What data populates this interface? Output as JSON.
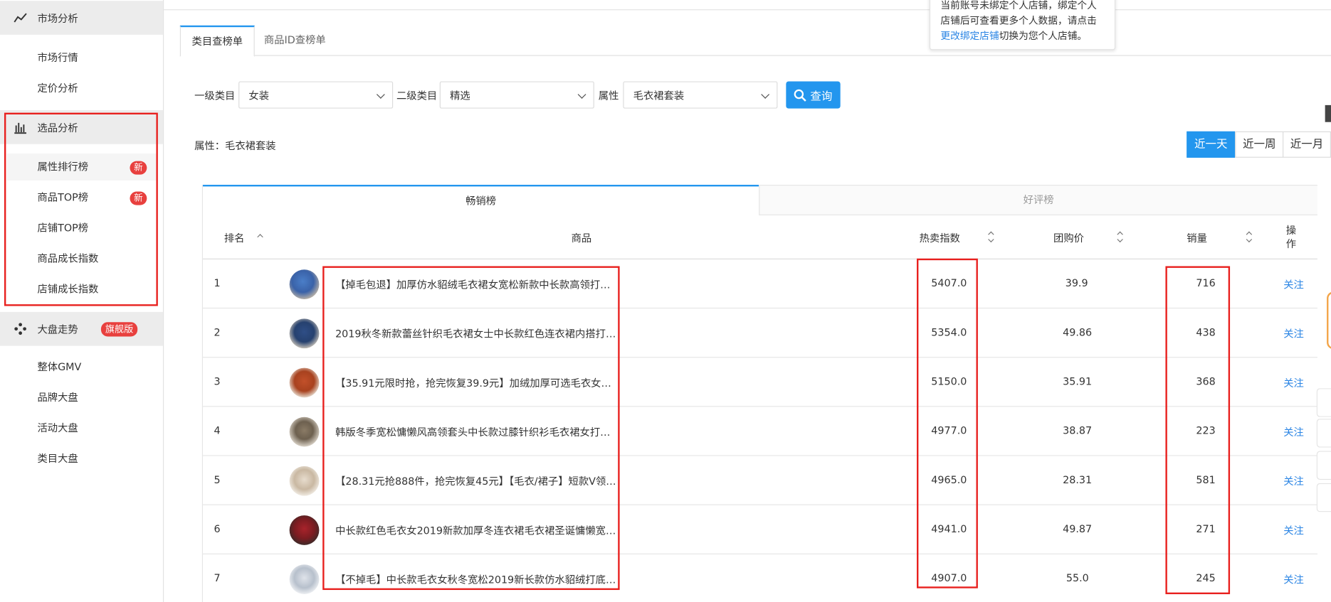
{
  "sidebar": {
    "market": {
      "title": "市场分析",
      "items": [
        "市场行情",
        "定价分析"
      ]
    },
    "selection": {
      "title": "选品分析",
      "items": [
        "属性排行榜",
        "商品TOP榜",
        "店铺TOP榜",
        "商品成长指数",
        "店铺成长指数"
      ],
      "new_badge": "新"
    },
    "overview": {
      "title": "大盘走势",
      "badge": "旗舰版",
      "items": [
        "整体GMV",
        "品牌大盘",
        "活动大盘",
        "类目大盘"
      ]
    }
  },
  "tabs": [
    "类目查榜单",
    "商品ID查榜单"
  ],
  "filters": {
    "cat1_label": "一级类目",
    "cat1_value": "女装",
    "cat2_label": "二级类目",
    "cat2_value": "精选",
    "attr_label": "属性",
    "attr_value": "毛衣裙套装",
    "query_label": "查询"
  },
  "attr_line": "属性：毛衣裙套装",
  "periods": [
    "近一天",
    "近一周",
    "近一月"
  ],
  "popover": {
    "line1": "当前账号未绑定个人店铺，绑定个人",
    "line2": "店铺后可查看更多个人数据，请点击",
    "link": "更改绑定店铺",
    "line3_rest": "切换为您个人店铺。"
  },
  "table": {
    "tabs": [
      "畅销榜",
      "好评榜"
    ],
    "headers": {
      "rank": "排名",
      "product": "商品",
      "hot": "热卖指数",
      "price": "团购价",
      "sales": "销量",
      "action": "操作"
    },
    "action_label": "关注",
    "rows": [
      {
        "rank": "1",
        "name": "【掉毛包退】加厚仿水貂绒毛衣裙女宽松新款中长款高领打底针织衫",
        "hot": "5407.0",
        "price": "39.9",
        "sales": "716"
      },
      {
        "rank": "2",
        "name": "2019秋冬新款蕾丝针织毛衣裙女士中长款红色连衣裙内搭打底衫加厚",
        "hot": "5354.0",
        "price": "49.86",
        "sales": "438"
      },
      {
        "rank": "3",
        "name": "【35.91元限时抢，抢完恢复39.9元】加绒加厚可选毛衣女宽松中长款…",
        "hot": "5150.0",
        "price": "35.91",
        "sales": "368"
      },
      {
        "rank": "4",
        "name": "韩版冬季宽松慵懒风高领套头中长款过膝针织衫毛衣裙女打底衫加厚",
        "hot": "4977.0",
        "price": "38.87",
        "sales": "223"
      },
      {
        "rank": "5",
        "name": "【28.31元抢888件，抢完恢复45元】【毛衣/裙子】短款V领针织衫女…",
        "hot": "4965.0",
        "price": "28.31",
        "sales": "581"
      },
      {
        "rank": "6",
        "name": "中长款红色毛衣女2019新款加厚冬连衣裙毛衣裙圣诞慵懒宽松外穿潮",
        "hot": "4941.0",
        "price": "49.87",
        "sales": "271"
      },
      {
        "rank": "7",
        "name": "【不掉毛】中长款毛衣女秋冬宽松2019新长款仿水貂绒打底毛衣裙冬",
        "hot": "4907.0",
        "price": "55.0",
        "sales": "245"
      }
    ]
  },
  "colors": {
    "accent": "#2396ee",
    "badge": "#e8403e",
    "highlight_box": "#e8201e",
    "link": "#2b85e4"
  }
}
